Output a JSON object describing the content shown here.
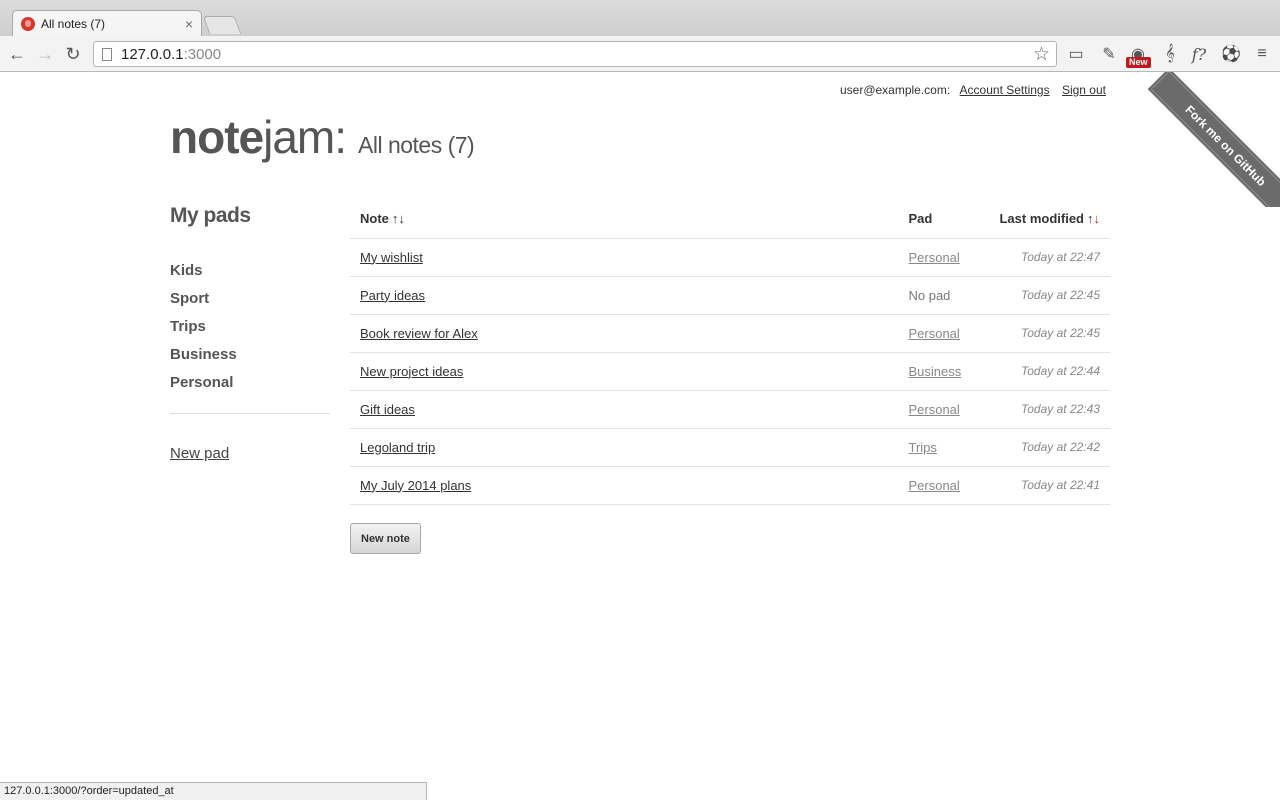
{
  "browser": {
    "tab_title": "All notes (7)",
    "tab_close": "×",
    "url_host": "127.0.0.1",
    "url_port": ":3000",
    "back": "←",
    "forward": "→",
    "reload": "↻",
    "star": "☆",
    "extensions": [
      "▭",
      "✎",
      "◉",
      "𝄞",
      "f?",
      "⚽",
      "≡"
    ],
    "extension_badge": "New",
    "status_url": "127.0.0.1:3000/?order=updated_at"
  },
  "header": {
    "user_email": "user@example.com:",
    "account_settings": "Account Settings",
    "sign_out": "Sign out",
    "ribbon": "Fork me on GitHub",
    "logo_note": "note",
    "logo_jam": "jam:",
    "page_title": "All notes (7)"
  },
  "sidebar": {
    "title": "My pads",
    "pads": [
      "Kids",
      "Sport",
      "Trips",
      "Business",
      "Personal"
    ],
    "new_pad": "New pad"
  },
  "table": {
    "headers": {
      "note": "Note",
      "note_sort": "↑↓",
      "pad": "Pad",
      "modified": "Last modified",
      "modified_sort_up": "↑",
      "modified_sort_down": "↓"
    },
    "rows": [
      {
        "note": "My wishlist",
        "pad": "Personal",
        "pad_link": true,
        "modified": "Today at 22:47"
      },
      {
        "note": "Party ideas",
        "pad": "No pad",
        "pad_link": false,
        "modified": "Today at 22:45"
      },
      {
        "note": "Book review for Alex",
        "pad": "Personal",
        "pad_link": true,
        "modified": "Today at 22:45"
      },
      {
        "note": "New project ideas",
        "pad": "Business",
        "pad_link": true,
        "modified": "Today at 22:44"
      },
      {
        "note": "Gift ideas",
        "pad": "Personal",
        "pad_link": true,
        "modified": "Today at 22:43"
      },
      {
        "note": "Legoland trip",
        "pad": "Trips",
        "pad_link": true,
        "modified": "Today at 22:42"
      },
      {
        "note": "My July 2014 plans",
        "pad": "Personal",
        "pad_link": true,
        "modified": "Today at 22:41"
      }
    ]
  },
  "new_note_label": "New note",
  "colors": {
    "accent_sort": "#c81f1f",
    "text": "#555555",
    "ribbon": "#6b6b6b"
  }
}
